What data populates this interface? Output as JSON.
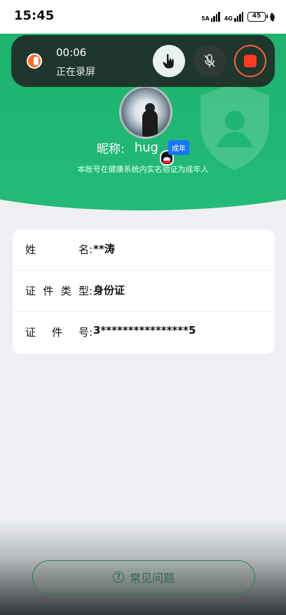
{
  "status_bar": {
    "time": "15:45",
    "network_1": "5A",
    "network_2": "4G",
    "battery": "45",
    "icons": [
      "signal-icon",
      "signal-icon",
      "battery-icon",
      "leaf-icon"
    ]
  },
  "recording": {
    "elapsed": "00:06",
    "status": "正在录屏",
    "buttons": [
      "touch-icon",
      "mic-off-icon",
      "stop-icon"
    ],
    "stop_color": "#ff3b22"
  },
  "profile": {
    "nickname_label": "昵称:",
    "nickname": "hug",
    "badge": "成年",
    "verify_note": "本账号在健康系统内实名验证为成年人",
    "brand_color": "#1db36e",
    "badge_color": "#1777ff"
  },
  "info": [
    {
      "label": "姓名:",
      "value": "**涛"
    },
    {
      "label": "证件类型:",
      "value": "身份证"
    },
    {
      "label": "证件号:",
      "value": "3****************5"
    }
  ],
  "footer": {
    "faq_label": "常见问题",
    "faq_icon": "?"
  }
}
